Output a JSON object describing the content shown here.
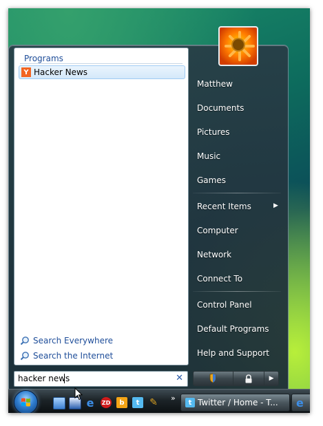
{
  "start_menu": {
    "programs_header": "Programs",
    "results": [
      {
        "label": "Hacker News",
        "icon": "y-combinator-icon",
        "icon_letter": "Y"
      }
    ],
    "search_links": [
      {
        "label": "Search Everywhere"
      },
      {
        "label": "Search the Internet"
      }
    ],
    "search_value": "hacker news",
    "right_items": [
      {
        "label": "Matthew"
      },
      {
        "label": "Documents"
      },
      {
        "label": "Pictures"
      },
      {
        "label": "Music"
      },
      {
        "label": "Games"
      },
      {
        "label": "Recent Items"
      },
      {
        "label": "Computer"
      },
      {
        "label": "Network"
      },
      {
        "label": "Connect To"
      },
      {
        "label": "Control Panel"
      },
      {
        "label": "Default Programs"
      },
      {
        "label": "Help and Support"
      }
    ]
  },
  "taskbar": {
    "quicklaunch_more": "»",
    "task_label": "Twitter / Home - T..."
  },
  "colors": {
    "accent": "#1e4d99",
    "highlight": "#d4e8fa",
    "yc_orange": "#f26522"
  }
}
